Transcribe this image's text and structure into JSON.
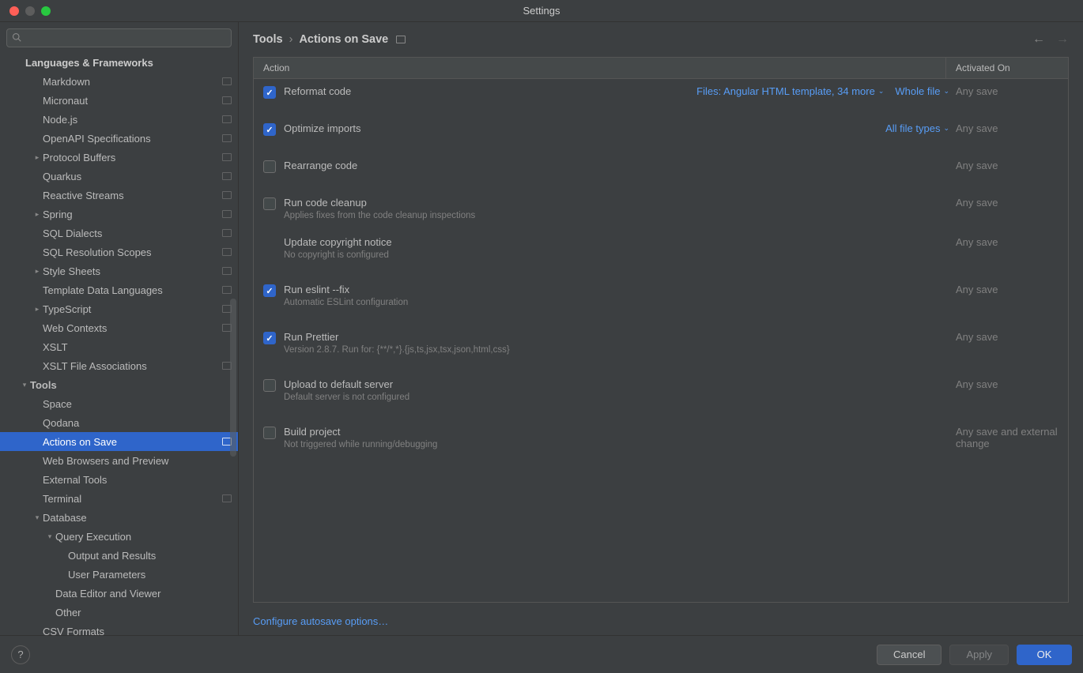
{
  "window": {
    "title": "Settings"
  },
  "search": {
    "placeholder": ""
  },
  "sidebar": {
    "header": "Languages & Frameworks",
    "items": [
      {
        "label": "Markdown",
        "depth": 2,
        "proj": true
      },
      {
        "label": "Micronaut",
        "depth": 2,
        "proj": true
      },
      {
        "label": "Node.js",
        "depth": 2,
        "proj": true
      },
      {
        "label": "OpenAPI Specifications",
        "depth": 2,
        "proj": true
      },
      {
        "label": "Protocol Buffers",
        "depth": 2,
        "proj": true,
        "chev": "right"
      },
      {
        "label": "Quarkus",
        "depth": 2,
        "proj": true
      },
      {
        "label": "Reactive Streams",
        "depth": 2,
        "proj": true
      },
      {
        "label": "Spring",
        "depth": 2,
        "proj": true,
        "chev": "right"
      },
      {
        "label": "SQL Dialects",
        "depth": 2,
        "proj": true
      },
      {
        "label": "SQL Resolution Scopes",
        "depth": 2,
        "proj": true
      },
      {
        "label": "Style Sheets",
        "depth": 2,
        "proj": true,
        "chev": "right"
      },
      {
        "label": "Template Data Languages",
        "depth": 2,
        "proj": true
      },
      {
        "label": "TypeScript",
        "depth": 2,
        "proj": true,
        "chev": "right"
      },
      {
        "label": "Web Contexts",
        "depth": 2,
        "proj": true
      },
      {
        "label": "XSLT",
        "depth": 2
      },
      {
        "label": "XSLT File Associations",
        "depth": 2,
        "proj": true
      },
      {
        "label": "Tools",
        "depth": 1,
        "chev": "down",
        "bold": true
      },
      {
        "label": "Space",
        "depth": 2
      },
      {
        "label": "Qodana",
        "depth": 2
      },
      {
        "label": "Actions on Save",
        "depth": 2,
        "proj": true,
        "selected": true
      },
      {
        "label": "Web Browsers and Preview",
        "depth": 2
      },
      {
        "label": "External Tools",
        "depth": 2
      },
      {
        "label": "Terminal",
        "depth": 2,
        "proj": true
      },
      {
        "label": "Database",
        "depth": 2,
        "chev": "down"
      },
      {
        "label": "Query Execution",
        "depth": 3,
        "chev": "down"
      },
      {
        "label": "Output and Results",
        "depth": 4
      },
      {
        "label": "User Parameters",
        "depth": 4
      },
      {
        "label": "Data Editor and Viewer",
        "depth": 3
      },
      {
        "label": "Other",
        "depth": 3
      },
      {
        "label": "CSV Formats",
        "depth": 2
      }
    ]
  },
  "breadcrumb": {
    "root": "Tools",
    "leaf": "Actions on Save"
  },
  "table": {
    "header": {
      "action": "Action",
      "activated": "Activated On"
    },
    "rows": [
      {
        "checked": true,
        "label": "Reformat code",
        "extras": [
          "Files: Angular HTML template, 34 more",
          "Whole file"
        ],
        "activated": "Any save"
      },
      {
        "checked": true,
        "label": "Optimize imports",
        "extras": [
          "All file types"
        ],
        "activated": "Any save"
      },
      {
        "checked": false,
        "label": "Rearrange code",
        "activated": "Any save"
      },
      {
        "checked": false,
        "label": "Run code cleanup",
        "desc": "Applies fixes from the code cleanup inspections",
        "activated": "Any save"
      },
      {
        "nocheck": true,
        "label": "Update copyright notice",
        "desc": "No copyright is configured",
        "activated": "Any save"
      },
      {
        "checked": true,
        "label": "Run eslint --fix",
        "desc": "Automatic ESLint configuration",
        "activated": "Any save"
      },
      {
        "checked": true,
        "label": "Run Prettier",
        "desc": "Version 2.8.7. Run for: {**/*,*}.{js,ts,jsx,tsx,json,html,css}",
        "activated": "Any save"
      },
      {
        "checked": false,
        "label": "Upload to default server",
        "desc": "Default server is not configured",
        "activated": "Any save"
      },
      {
        "checked": false,
        "label": "Build project",
        "desc": "Not triggered while running/debugging",
        "activated": "Any save and external change"
      }
    ]
  },
  "configure_link": "Configure autosave options…",
  "buttons": {
    "cancel": "Cancel",
    "apply": "Apply",
    "ok": "OK"
  }
}
